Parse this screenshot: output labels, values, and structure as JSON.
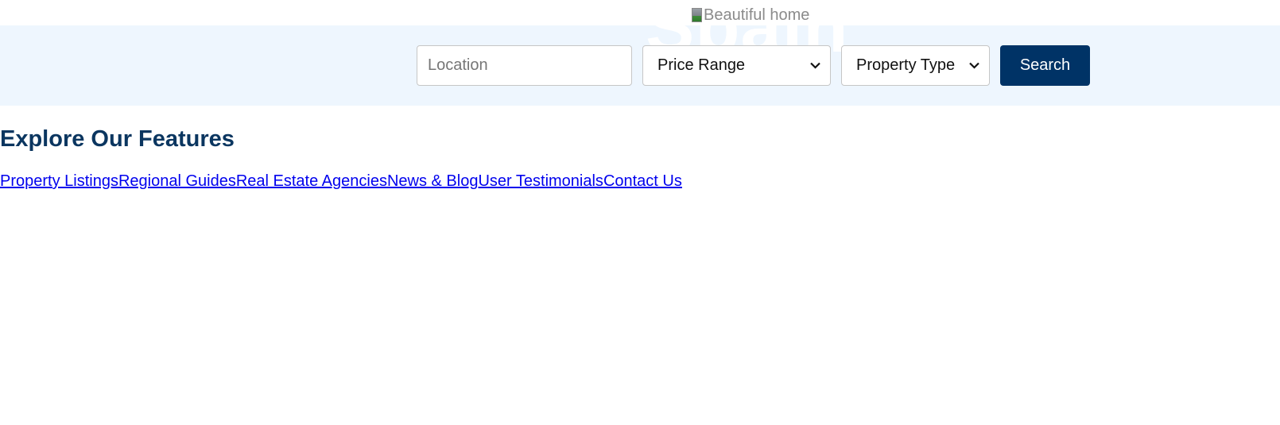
{
  "hero": {
    "title": "Spain",
    "image_alt": "Beautiful home"
  },
  "search": {
    "location_placeholder": "Location",
    "price_range": "Price Range",
    "property_type": "Property Type",
    "button_label": "Search"
  },
  "features": {
    "heading": "Explore Our Features",
    "links": [
      "Property Listings",
      "Regional Guides",
      "Real Estate Agencies",
      "News & Blog",
      "User Testimonials",
      "Contact Us"
    ]
  },
  "colors": {
    "hero_background": "#eef6fe",
    "brand_navy": "#003366",
    "heading": "#0b3660",
    "link": "#0000ee"
  },
  "icons": {
    "select_arrow": "chevron-down-icon",
    "broken_image": "broken-image-icon"
  }
}
